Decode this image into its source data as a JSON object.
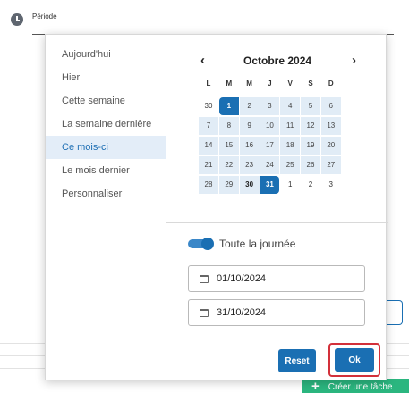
{
  "period": {
    "label": "Période"
  },
  "presets": [
    {
      "label": "Aujourd'hui",
      "active": false
    },
    {
      "label": "Hier",
      "active": false
    },
    {
      "label": "Cette semaine",
      "active": false
    },
    {
      "label": "La semaine dernière",
      "active": false
    },
    {
      "label": "Ce mois-ci",
      "active": true
    },
    {
      "label": "Le mois dernier",
      "active": false
    },
    {
      "label": "Personnaliser",
      "active": false
    }
  ],
  "calendar": {
    "prev_icon": "‹",
    "next_icon": "›",
    "title": "Octobre 2024",
    "weekdays": [
      "L",
      "M",
      "M",
      "J",
      "V",
      "S",
      "D"
    ],
    "weeks": [
      [
        "30",
        "1",
        "2",
        "3",
        "4",
        "5",
        "6"
      ],
      [
        "7",
        "8",
        "9",
        "10",
        "11",
        "12",
        "13"
      ],
      [
        "14",
        "15",
        "16",
        "17",
        "18",
        "19",
        "20"
      ],
      [
        "21",
        "22",
        "23",
        "24",
        "25",
        "26",
        "27"
      ],
      [
        "28",
        "29",
        "30",
        "31",
        "1",
        "2",
        "3"
      ]
    ],
    "range_start": "1",
    "range_end": "31"
  },
  "all_day": {
    "label": "Toute la journée",
    "checked": true
  },
  "start_date": {
    "value": "01/10/2024",
    "icon": "calendar-icon"
  },
  "end_date": {
    "value": "31/10/2024",
    "icon": "calendar-icon"
  },
  "buttons": {
    "reset": "Reset",
    "ok": "Ok"
  },
  "background": {
    "create_task": "Créer une tâche"
  },
  "colors": {
    "accent": "#1a6fb3",
    "range": "#e1ecf6",
    "highlight": "#d3303a",
    "green": "#2bb67f"
  }
}
